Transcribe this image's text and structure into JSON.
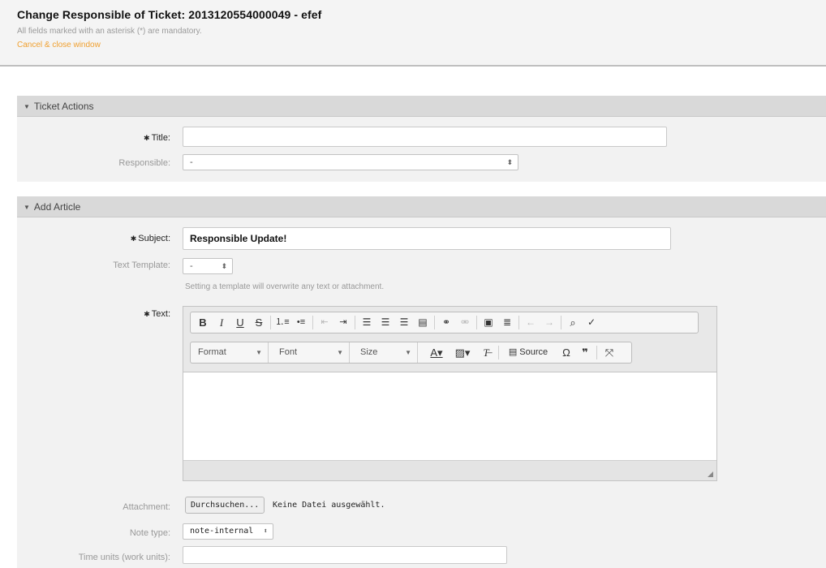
{
  "header": {
    "title": "Change Responsible of Ticket: 2013120554000049 - efef",
    "mandatory_note": "All fields marked with an asterisk (*) are mandatory.",
    "cancel_link": "Cancel & close window"
  },
  "ticket_actions": {
    "heading": "Ticket Actions",
    "title_label": "Title:",
    "title_value": "",
    "responsible_label": "Responsible:",
    "responsible_value": "-"
  },
  "add_article": {
    "heading": "Add Article",
    "subject_label": "Subject:",
    "subject_value": "Responsible Update!",
    "text_template_label": "Text Template:",
    "text_template_value": "-",
    "template_hint": "Setting a template will overwrite any text or attachment.",
    "text_label": "Text:",
    "attachment_label": "Attachment:",
    "browse_button": "Durchsuchen...",
    "no_file": "Keine Datei ausgewählt.",
    "note_type_label": "Note type:",
    "note_type_value": "note-internal",
    "time_units_label": "Time units (work units):",
    "time_units_value": ""
  },
  "editor": {
    "format": "Format",
    "font": "Font",
    "size": "Size",
    "source": "Source"
  },
  "icons": {
    "required": "asterisk-icon",
    "collapse": "triangle-down-icon"
  },
  "colors": {
    "header_bg": "#f4f4f4",
    "section_head_bg": "#d9d9d9",
    "cancel_link": "#f0a030"
  }
}
